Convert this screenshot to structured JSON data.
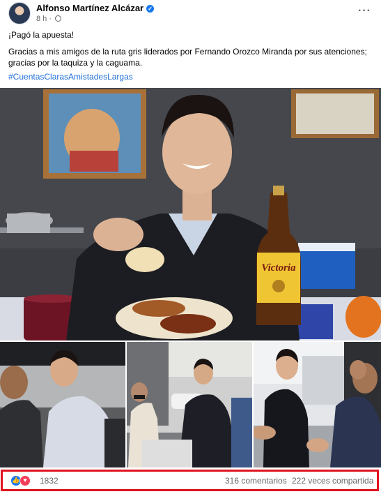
{
  "post": {
    "author": "Alfonso Martínez Alcázar",
    "time": "8 h",
    "line1": "¡Pagó la apuesta!",
    "line2": "Gracias a mis amigos de la ruta gris liderados por Fernando Orozco Miranda por sus atenciones;",
    "line3": "gracias por la taquiza y la caguama.",
    "hashtag": "#CuentasClarasAmistadesLargas",
    "beer_label": "Victoria"
  },
  "stats": {
    "reaction_count": "1832",
    "comments": "316 comentarios",
    "shares": "222 veces compartida",
    "icons": [
      "like-icon",
      "love-icon"
    ]
  },
  "icons": [
    "verified-icon",
    "globe-icon",
    "more-options-icon"
  ],
  "colors": {
    "brand_blue": "#1877f2",
    "highlight_red": "#e0141e",
    "hashtag": "#216fdb"
  }
}
